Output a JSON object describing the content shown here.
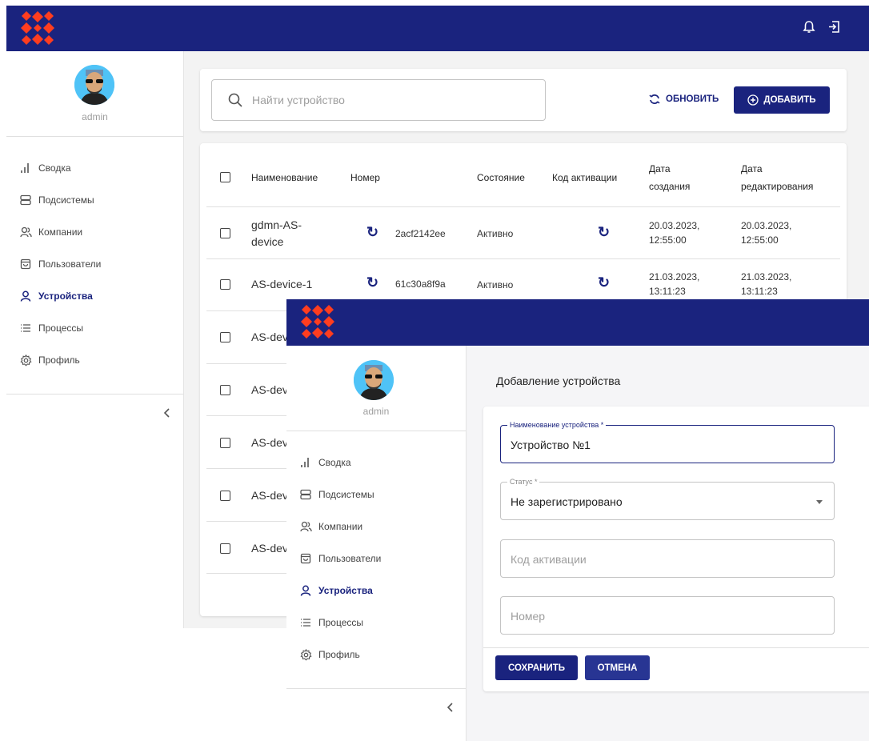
{
  "colors": {
    "brand": "#1a237e",
    "logo": "#ff3d1f",
    "avatar_bg": "#4fc3f7"
  },
  "user": {
    "name": "admin"
  },
  "sidebar": {
    "items": [
      {
        "label": "Сводка",
        "icon": "bar-chart-icon"
      },
      {
        "label": "Подсистемы",
        "icon": "servers-icon"
      },
      {
        "label": "Компании",
        "icon": "people-icon"
      },
      {
        "label": "Пользователи",
        "icon": "bag-icon"
      },
      {
        "label": "Устройства",
        "icon": "person-icon",
        "active": true
      },
      {
        "label": "Процессы",
        "icon": "list-icon"
      },
      {
        "label": "Профиль",
        "icon": "gear-icon"
      }
    ],
    "collapse_icon": "chevron-left-icon"
  },
  "toolbar": {
    "search_placeholder": "Найти устройство",
    "refresh_label": "ОБНОВИТЬ",
    "add_label": "ДОБАВИТЬ"
  },
  "table": {
    "headers": {
      "name": "Наименование",
      "number": "Номер",
      "state": "Состояние",
      "activation_code": "Код активации",
      "created_1": "Дата",
      "created_2": "создания",
      "edited_1": "Дата",
      "edited_2": "редактирования"
    },
    "rows": [
      {
        "name_1": "gdmn-AS-",
        "name_2": "device",
        "number": "2acf2142ee",
        "state": "Активно",
        "created_1": "20.03.2023,",
        "created_2": "12:55:00",
        "edited_1": "20.03.2023,",
        "edited_2": "12:55:00"
      },
      {
        "name_1": "AS-device-1",
        "number": "61c30a8f9a",
        "state": "Активно",
        "created_1": "21.03.2023,",
        "created_2": "13:11:23",
        "edited_1": "21.03.2023,",
        "edited_2": "13:11:23"
      },
      {
        "name_1": "AS-dev"
      },
      {
        "name_1": "AS-dev"
      },
      {
        "name_1": "AS-dev"
      },
      {
        "name_1": "AS-dev"
      },
      {
        "name_1": "AS-dev"
      }
    ]
  },
  "form": {
    "title": "Добавление устройства",
    "name_label": "Наименование устройства *",
    "name_value": "Устройство №1",
    "status_label": "Статус *",
    "status_value": "Не зарегистрировано",
    "code_placeholder": "Код активации",
    "number_placeholder": "Номер",
    "save_label": "СОХРАНИТЬ",
    "cancel_label": "ОТМЕНА"
  }
}
